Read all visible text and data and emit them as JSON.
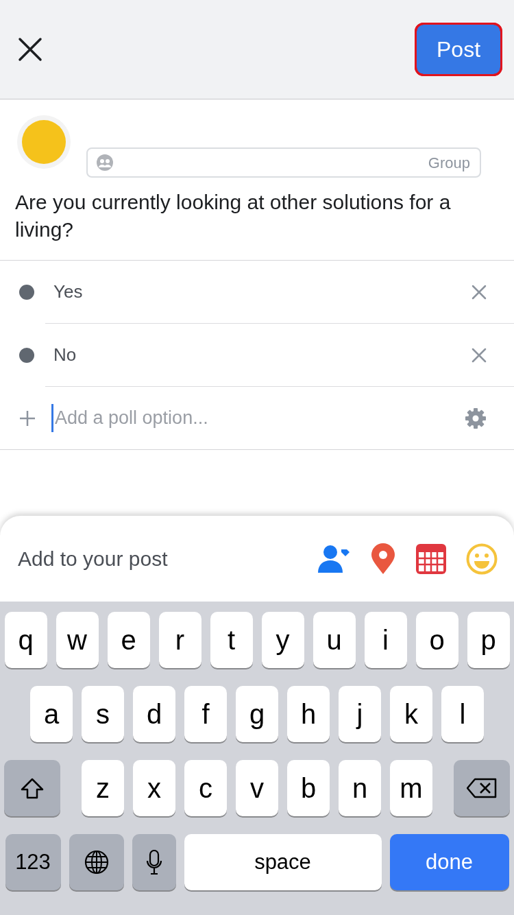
{
  "header": {
    "post_button": {
      "label": "Post",
      "highlighted": true
    }
  },
  "audience": {
    "label": "Group"
  },
  "question": "Are you currently looking at other solutions for a living?",
  "options": [
    {
      "label": "Yes"
    },
    {
      "label": "No"
    }
  ],
  "new_option": {
    "placeholder": "Add a poll option...",
    "focused": true
  },
  "add_to_post": {
    "label": "Add to your post"
  },
  "keyboard": {
    "letters_top": [
      {
        "kind": "letter",
        "label": "q"
      },
      {
        "kind": "letter",
        "label": "w"
      },
      {
        "kind": "letter",
        "label": "e"
      },
      {
        "kind": "letter",
        "label": "r"
      },
      {
        "kind": "letter",
        "label": "t"
      },
      {
        "kind": "letter",
        "label": "y"
      },
      {
        "kind": "letter",
        "label": "u"
      },
      {
        "kind": "letter",
        "label": "i"
      },
      {
        "kind": "letter",
        "label": "o"
      },
      {
        "kind": "letter",
        "label": "p"
      }
    ],
    "letters_middle": [
      {
        "kind": "letter",
        "label": "a"
      },
      {
        "kind": "letter",
        "label": "s"
      },
      {
        "kind": "letter",
        "label": "d"
      },
      {
        "kind": "letter",
        "label": "f"
      },
      {
        "kind": "letter",
        "label": "g"
      },
      {
        "kind": "letter",
        "label": "h"
      },
      {
        "kind": "letter",
        "label": "j"
      },
      {
        "kind": "letter",
        "label": "k"
      },
      {
        "kind": "letter",
        "label": "l"
      }
    ],
    "letters_bottom": [
      {
        "kind": "shift"
      },
      {
        "kind": "letter",
        "label": "z"
      },
      {
        "kind": "letter",
        "label": "x"
      },
      {
        "kind": "letter",
        "label": "c"
      },
      {
        "kind": "letter",
        "label": "v"
      },
      {
        "kind": "letter",
        "label": "b"
      },
      {
        "kind": "letter",
        "label": "n"
      },
      {
        "kind": "letter",
        "label": "m"
      },
      {
        "kind": "delete"
      }
    ],
    "function_keys": [
      {
        "kind": "numbers",
        "label": "123"
      },
      {
        "kind": "globe"
      },
      {
        "kind": "mic"
      },
      {
        "kind": "space",
        "label": "space"
      },
      {
        "kind": "done",
        "label": "done"
      }
    ]
  }
}
